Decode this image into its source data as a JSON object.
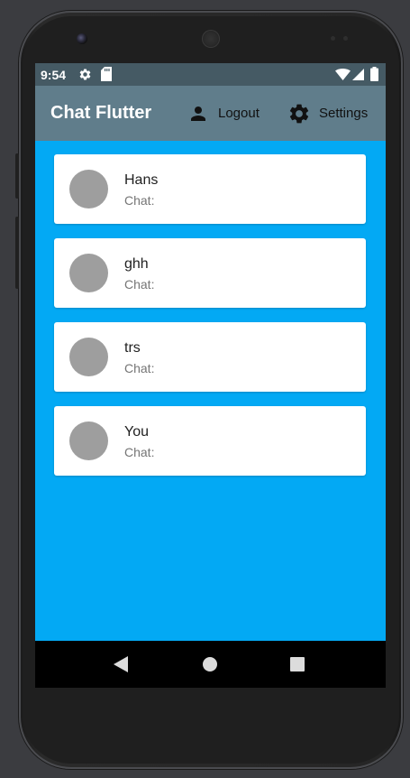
{
  "status_bar": {
    "time": "9:54",
    "left_icons": [
      "gear-icon",
      "sd-card-icon"
    ],
    "right_icons": [
      "wifi-icon",
      "signal-icon",
      "battery-icon"
    ]
  },
  "app_bar": {
    "title": "Chat Flutter",
    "actions": [
      {
        "icon": "person-icon",
        "label": "Logout"
      },
      {
        "icon": "gear-icon",
        "label": "Settings"
      }
    ]
  },
  "chats": [
    {
      "name": "Hans",
      "subtitle": "Chat:"
    },
    {
      "name": "ghh",
      "subtitle": "Chat:"
    },
    {
      "name": "trs",
      "subtitle": "Chat:"
    },
    {
      "name": "You",
      "subtitle": "Chat:"
    }
  ],
  "nav_bar": {
    "buttons": [
      "back-icon",
      "home-icon",
      "recents-icon"
    ]
  },
  "colors": {
    "status_bar": "#455a64",
    "app_bar": "#607d8b",
    "background": "#03a9f4",
    "avatar": "#9e9e9e"
  }
}
